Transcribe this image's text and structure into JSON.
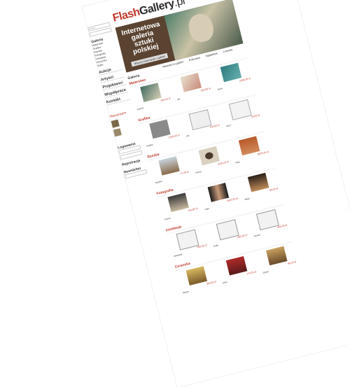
{
  "logo": {
    "flash": "Flash",
    "gallery": "Gallery",
    "tld": ".pl"
  },
  "hero": {
    "line1": "Internetowa",
    "line2": "galeria",
    "line3": "sztuki",
    "line4": "polskiej",
    "button": "Więcej informacji o galerii"
  },
  "topnav": [
    "Galeria",
    "Nowości w galerii",
    "Polecane",
    "Najtańsze",
    "Losowe"
  ],
  "sidebar": {
    "login_placeholder": "Szukaj",
    "gallery_head": "Galeria",
    "gallery_items": [
      "Malarstwo",
      "Grafika",
      "Rzeźba",
      "Fotografia",
      "Instalacja",
      "Ceramika",
      "Szkło"
    ],
    "links": [
      "Aukcje",
      "Artyści",
      "Projektanci",
      "Współpraca",
      "Kontakt"
    ],
    "news_head": "Newsroom",
    "login_head": "Logowanie",
    "register_head": "Rejestracja",
    "newsletter_head": "Newsletter"
  },
  "sections": [
    {
      "title": "Malarstwo",
      "items": [
        {
          "name": "Portrait",
          "price": "450,00 zł"
        },
        {
          "name": "Akt",
          "price": "320,00 zł"
        },
        {
          "name": "Tęcza",
          "price": "2300,00 zł"
        }
      ]
    },
    {
      "title": "Grafika",
      "items": [
        {
          "name": "Grafika",
          "price": "1200,00 zł"
        },
        {
          "name": "Akt",
          "price": "150,00 zł"
        },
        {
          "name": "Akt 2",
          "price": "25,00 zł"
        }
      ]
    },
    {
      "title": "Rzeźba",
      "items": [
        {
          "name": "Rzeźba",
          "price": "17,00 zł"
        },
        {
          "name": "Forma",
          "price": "2100,00 zł"
        },
        {
          "name": "Płód",
          "price": "8875,00 zł"
        }
      ]
    },
    {
      "title": "Fotografia",
      "items": [
        {
          "name": "Portret",
          "price": "450,00 zł"
        },
        {
          "name": "Ciało",
          "price": "5437,00 zł"
        },
        {
          "name": "Wizja",
          "price": "80,00 zł"
        }
      ]
    },
    {
      "title": "Instalacja",
      "items": [
        {
          "name": "Instalacja",
          "price": "600,00 zł"
        },
        {
          "name": "Pętla",
          "price": "180,00 zł"
        },
        {
          "name": "Spirala",
          "price": "400,00 zł"
        }
      ]
    },
    {
      "title": "Ceramika",
      "items": [
        {
          "name": "Wazon",
          "price": "450,00 zł"
        },
        {
          "name": "Misa",
          "price": "175,00 zł"
        },
        {
          "name": "Dzban",
          "price": "90,00 zł"
        }
      ]
    }
  ],
  "colors": {
    "accent": "#c0392b",
    "text": "#2a2a2a"
  }
}
